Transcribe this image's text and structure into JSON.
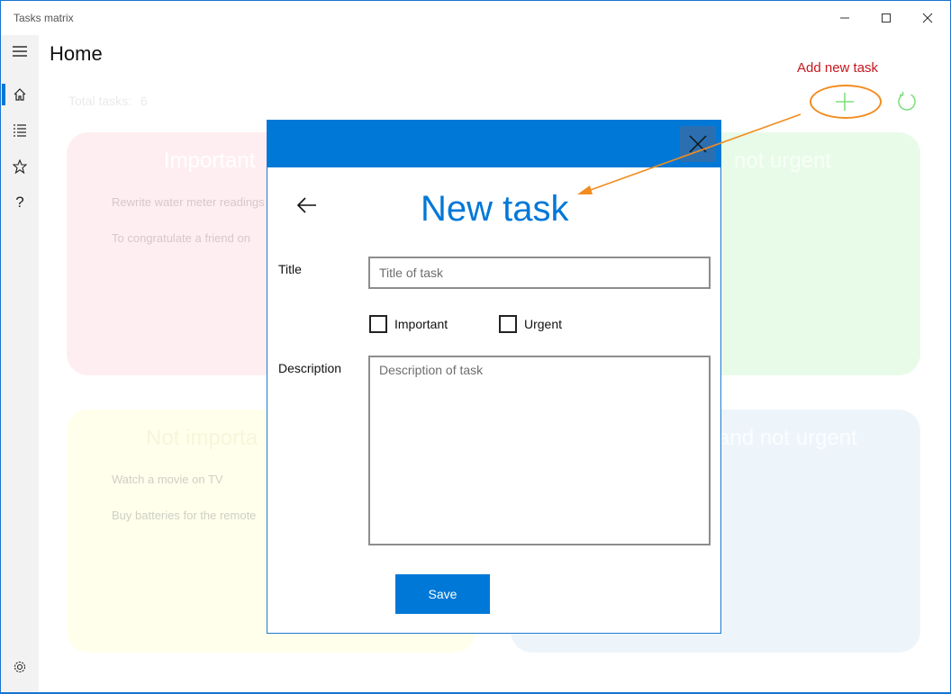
{
  "window": {
    "title": "Tasks matrix"
  },
  "nav": {
    "items": [
      {
        "icon": "hamburger-icon"
      },
      {
        "icon": "home-icon",
        "active": true
      },
      {
        "icon": "list-icon"
      },
      {
        "icon": "star-icon"
      },
      {
        "icon": "help-icon",
        "glyph": "?"
      },
      {
        "icon": "settings-icon"
      }
    ]
  },
  "page": {
    "title": "Home",
    "total_tasks_label": "Total tasks:",
    "total_tasks_value": "6"
  },
  "annotation": {
    "label": "Add new task",
    "color": "#c7171e",
    "ellipse_color": "#f28c1e"
  },
  "toolbar": {
    "add_icon": "plus-icon",
    "refresh_icon": "refresh-icon",
    "icon_color": "#7fe07f"
  },
  "quadrants": [
    {
      "title": "Important",
      "items": [
        "Rewrite water meter readings",
        "To congratulate a friend on"
      ]
    },
    {
      "title": "not urgent",
      "items": []
    },
    {
      "title": "Not importa",
      "items": [
        "Watch a movie on TV",
        "Buy batteries for the remote"
      ]
    },
    {
      "title": "and not urgent",
      "items": []
    }
  ],
  "dialog": {
    "heading": "New task",
    "title_label": "Title",
    "title_placeholder": "Title of task",
    "title_value": "",
    "important_label": "Important",
    "important_checked": false,
    "urgent_label": "Urgent",
    "urgent_checked": false,
    "description_label": "Description",
    "description_placeholder": "Description of task",
    "description_value": "",
    "save_label": "Save",
    "accent": "#0078d7"
  }
}
